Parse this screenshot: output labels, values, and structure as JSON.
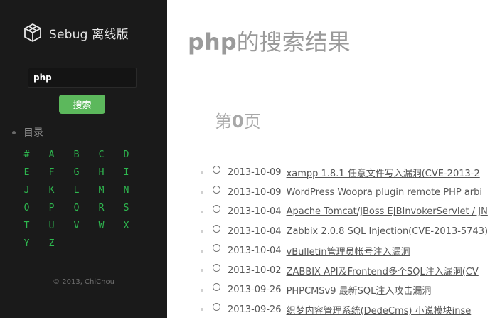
{
  "sidebar": {
    "logo_text": "Sebug 离线版",
    "search_value": "php",
    "search_button": "搜索",
    "directory_label": "目录",
    "letters": [
      "#",
      "A",
      "B",
      "C",
      "D",
      "E",
      "F",
      "G",
      "H",
      "I",
      "J",
      "K",
      "L",
      "M",
      "N",
      "O",
      "P",
      "Q",
      "R",
      "S",
      "T",
      "U",
      "V",
      "W",
      "X",
      "Y",
      "Z"
    ],
    "copyright": "© 2013, ChiChou"
  },
  "main": {
    "title_keyword": "php",
    "title_suffix": "的搜索结果",
    "page_prefix": "第",
    "page_number": "0",
    "page_suffix": "页",
    "results": [
      {
        "date": "2013-10-09",
        "title": "xampp 1.8.1 任意文件写入漏洞(CVE-2013-2"
      },
      {
        "date": "2013-10-09",
        "title": "WordPress Woopra plugin remote PHP arbi"
      },
      {
        "date": "2013-10-04",
        "title": "Apache Tomcat/JBoss EJBInvokerServlet / JN"
      },
      {
        "date": "2013-10-04",
        "title": "Zabbix 2.0.8 SQL Injection(CVE-2013-5743)"
      },
      {
        "date": "2013-10-04",
        "title": "vBulletin管理员帐号注入漏洞"
      },
      {
        "date": "2013-10-02",
        "title": "ZABBIX API及Frontend多个SQL注入漏洞(CV"
      },
      {
        "date": "2013-09-26",
        "title": "PHPCMSv9 最新SQL注入攻击漏洞"
      },
      {
        "date": "2013-09-26",
        "title": "织梦内容管理系统(DedeCms) 小说模块inse"
      }
    ]
  },
  "colors": {
    "sidebar_bg": "#1a1a1a",
    "accent_green": "#5cb85c",
    "letter_green": "#2eb84f"
  }
}
